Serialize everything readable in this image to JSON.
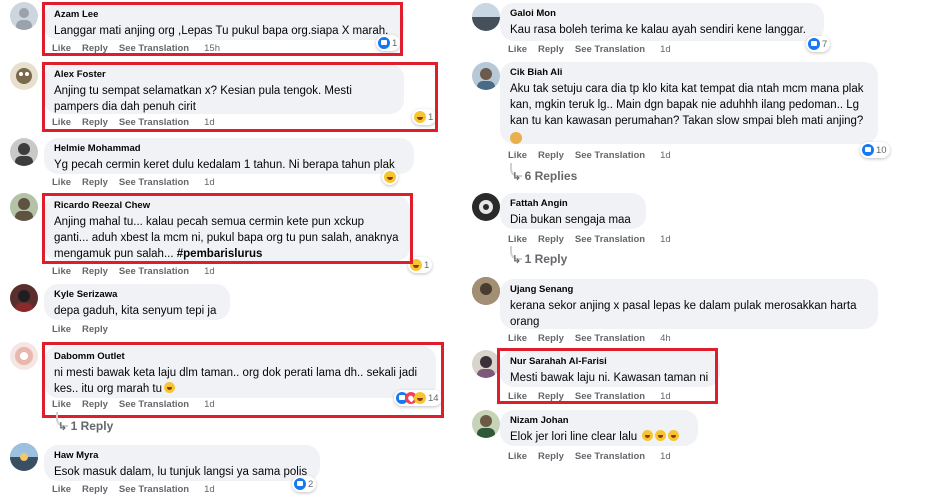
{
  "labels": {
    "like": "Like",
    "reply": "Reply",
    "see_translation": "See Translation"
  },
  "left": [
    {
      "author": "Azam Lee",
      "text": "Langgar mati anjing org ,Lepas Tu pukul bapa org.siapa X marah.",
      "time": "15h",
      "reaction": "like",
      "count": "1"
    },
    {
      "author": "Alex Foster",
      "text": "Anjing tu sempat selamatkan x? Kesian pula tengok. Mesti pampers dia dah penuh cirit",
      "time": "1d",
      "reaction": "haha",
      "count": "1"
    },
    {
      "author": "Helmie Mohammad",
      "text": "Yg pecah cermin keret dulu kedalam 1 tahun. Ni berapa tahun plak",
      "time": "1d",
      "reaction": "haha",
      "count": ""
    },
    {
      "author": "Ricardo Reezal Chew",
      "text": "Anjing mahal tu... kalau pecah semua cermin kete pun xckup ganti... aduh xbest la mcm ni, pukul bapa org tu pun salah, anaknya mengamuk pun salah...",
      "hashtag": "#pembarislurus",
      "time": "1d",
      "reaction": "haha",
      "count": "1"
    },
    {
      "author": "Kyle Serizawa",
      "text": "depa gaduh, kita senyum tepi ja",
      "time": "1d",
      "reaction": "",
      "count": ""
    },
    {
      "author": "Dabomm Outlet",
      "text": "ni mesti bawak keta laju dlm taman.. org dok perati lama dh.. sekali jadi kes.. itu org marah tu",
      "time": "1d",
      "reaction": "mixed",
      "count": "14"
    },
    {
      "author": "Haw Myra",
      "text": "Esok masuk dalam, lu tunjuk langsi ya sama polis",
      "time": "1d",
      "reaction": "like",
      "count": "2"
    }
  ],
  "left_replies": "1 Reply",
  "right": [
    {
      "author": "Galoi Mon",
      "text": "Kau rasa boleh terima ke kalau ayah sendiri kene langgar.",
      "time": "1d",
      "reaction": "like",
      "count": "7"
    },
    {
      "author": "Cik Biah Ali",
      "text": "Aku tak setuju cara dia tp klo kita kat tempat dia ntah mcm mana plak kan, mgkin teruk lg.. Main dgn bapak nie aduhhh ilang pedoman.. Lg kan tu kan kawasan perumahan? Takan slow smpai bleh mati anjing?",
      "time": "1d",
      "reaction": "like",
      "count": "10"
    },
    {
      "author": "Fattah Angin",
      "text": "Dia bukan sengaja maa",
      "time": "1d",
      "reaction": "",
      "count": ""
    },
    {
      "author": "Ujang Senang",
      "text": "kerana sekor anjing x pasal lepas ke dalam pulak merosakkan harta orang",
      "time": "4h",
      "reaction": "",
      "count": ""
    },
    {
      "author": "Nur Sarahah Al-Farisi",
      "text": "Mesti bawak laju ni. Kawasan taman ni",
      "time": "1d",
      "reaction": "",
      "count": ""
    },
    {
      "author": "Nizam Johan",
      "text": "Elok jer lori line clear lalu",
      "time": "1d",
      "reaction": "",
      "count": ""
    }
  ],
  "right_replies": [
    "6 Replies",
    "1 Reply"
  ],
  "colors": {
    "highlight": "#e01e2b",
    "bubble": "#f0f2f5",
    "meta": "#65676b",
    "like": "#1877f2"
  }
}
